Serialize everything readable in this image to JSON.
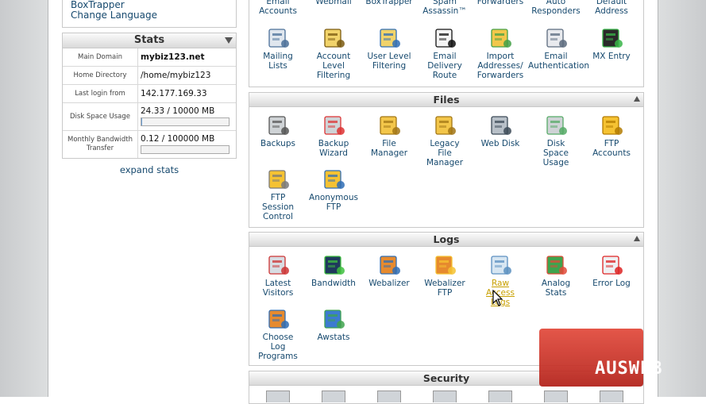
{
  "links": {
    "boxtrapper": "BoxTrapper",
    "change_language": "Change Language"
  },
  "stats": {
    "title": "Stats",
    "rows": [
      {
        "label": "Main Domain",
        "value": "mybiz123.net"
      },
      {
        "label": "Home Directory",
        "value": "/home/mybiz123"
      },
      {
        "label": "Last login from",
        "value": "142.177.169.33"
      },
      {
        "label": "Disk Space Usage",
        "value": "24.33 / 10000 MB",
        "fraction": 0.0024
      },
      {
        "label": "Monthly Bandwidth Transfer",
        "value": "0.12 / 100000 MB",
        "fraction": 1.2e-06
      }
    ],
    "expand": "expand stats"
  },
  "mail_top_labels": [
    "Email\nAccounts",
    "Webmail",
    "BoxTrapper",
    "Spam\nAssassin™",
    "Forwarders",
    "Auto\nResponders",
    "Default\nAddress"
  ],
  "mail_items": [
    {
      "label": "Mailing\nLists",
      "icon": "mailing-lists-icon"
    },
    {
      "label": "Account\nLevel\nFiltering",
      "icon": "account-level-filtering-icon"
    },
    {
      "label": "User Level\nFiltering",
      "icon": "user-level-filtering-icon"
    },
    {
      "label": "Email\nDelivery\nRoute",
      "icon": "email-delivery-route-icon"
    },
    {
      "label": "Import\nAddresses/\nForwarders",
      "icon": "import-addresses-icon"
    },
    {
      "label": "Email\nAuthentication",
      "icon": "email-authentication-icon"
    },
    {
      "label": "MX Entry",
      "icon": "mx-entry-icon"
    }
  ],
  "files": {
    "title": "Files",
    "items": [
      {
        "label": "Backups",
        "icon": "backups-icon"
      },
      {
        "label": "Backup\nWizard",
        "icon": "backup-wizard-icon"
      },
      {
        "label": "File\nManager",
        "icon": "file-manager-icon"
      },
      {
        "label": "Legacy\nFile\nManager",
        "icon": "legacy-file-manager-icon"
      },
      {
        "label": "Web Disk",
        "icon": "web-disk-icon"
      },
      {
        "label": "Disk\nSpace\nUsage",
        "icon": "disk-space-usage-icon"
      },
      {
        "label": "FTP\nAccounts",
        "icon": "ftp-accounts-icon"
      },
      {
        "label": "FTP\nSession\nControl",
        "icon": "ftp-session-control-icon"
      },
      {
        "label": "Anonymous\nFTP",
        "icon": "anonymous-ftp-icon"
      }
    ]
  },
  "logs": {
    "title": "Logs",
    "items": [
      {
        "label": "Latest\nVisitors",
        "icon": "latest-visitors-icon"
      },
      {
        "label": "Bandwidth",
        "icon": "bandwidth-icon"
      },
      {
        "label": "Webalizer",
        "icon": "webalizer-icon"
      },
      {
        "label": "Webalizer\nFTP",
        "icon": "webalizer-ftp-icon"
      },
      {
        "label": "Raw\nAccess\nLogs",
        "icon": "raw-access-logs-icon"
      },
      {
        "label": "Analog\nStats",
        "icon": "analog-stats-icon"
      },
      {
        "label": "Error Log",
        "icon": "error-log-icon"
      },
      {
        "label": "Choose\nLog\nPrograms",
        "icon": "choose-log-programs-icon"
      },
      {
        "label": "Awstats",
        "icon": "awstats-icon"
      }
    ]
  },
  "security": {
    "title": "Security"
  },
  "watermark": "AUSWEB",
  "colors": {
    "link": "#16496e",
    "hover": "#c8a000",
    "watermark": "#d33a2e"
  }
}
